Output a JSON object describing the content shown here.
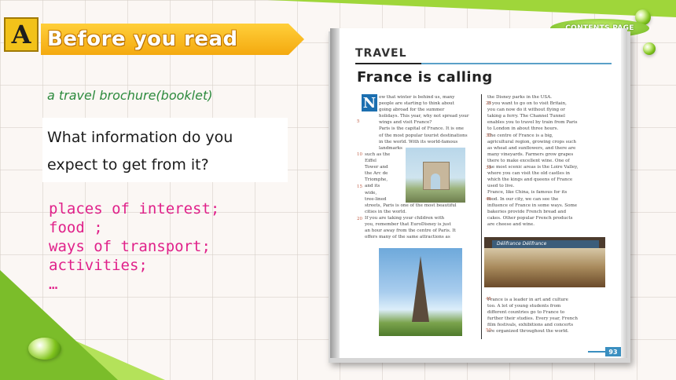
{
  "slide": {
    "badge_letter": "A",
    "title": "Before you read",
    "contents_button": "CONTENTS PAGE",
    "subtitle": "a travel brochure(booklet)",
    "question_lines": [
      "What information do you",
      "expect to get from it?"
    ],
    "answers": [
      "places of interest;",
      "food ;",
      "ways of transport;",
      "activities;",
      "…"
    ]
  },
  "magazine": {
    "section_label": "TRAVEL",
    "article_title": "France is calling",
    "dropcap": "N",
    "col1_top": [
      "ow that winter is behind us, many",
      "people are starting to think about",
      "going abroad for the summer",
      "holidays. This year, why not spread your",
      "wings and visit France?",
      "Paris is the capital of France. It is one",
      "of the most popular tourist destinations",
      "in the world. With its world-famous",
      "landmarks"
    ],
    "col1_side": [
      "such as the",
      "Eiffel",
      "Tower and",
      "the Arc de",
      "Triomphe,",
      "and its",
      "wide,",
      "tree-lined"
    ],
    "col1_bottom": [
      "streets, Paris is one of the most beautiful",
      "cities in the world.",
      "If you are taking your children with",
      "you, remember that EuroDisney is just",
      "an hour away from the centre of Paris. It",
      "offers many of the same attractions as"
    ],
    "col2_top": [
      "the Disney parks in the USA.",
      "If you want to go on to visit Britain,",
      "you can now do it without flying or",
      "taking a ferry. The Channel Tunnel",
      "enables you to travel by train from Paris",
      "to London in about three hours.",
      "The centre of France is a big,",
      "agricultural region, growing crops such",
      "as wheat and sunflowers, and there are",
      "many vineyards. Farmers grow grapes",
      "there to make excellent wine. One of",
      "the most scenic areas is the Loire Valley,",
      "where you can visit the old castles in",
      "which the kings and queens of France",
      "used to live.",
      "France, like China, is famous for its",
      "food. In our city, we can see the",
      "influence of France in some ways. Some",
      "bakeries provide French bread and",
      "cakes. Other popular French products",
      "are cheese and wine."
    ],
    "col2_bottom": [
      "France is a leader in art and culture",
      "too. A lot of young students from",
      "different countries go to France to",
      "further their studies. Every year, French",
      "film festivals, exhibitions and concerts",
      "are organized throughout the world."
    ],
    "line_numbers": [
      "5",
      "10",
      "15",
      "20",
      "25",
      "30",
      "35",
      "40",
      "45",
      "50"
    ],
    "shop_sign": "Délifrance      Délifrance",
    "page_number": "93"
  },
  "colors": {
    "accent_orange": "#f4a90f",
    "badge_yellow": "#f2c21a",
    "subtitle_green": "#2c8a3d",
    "answer_pink": "#e0218a",
    "brand_green": "#7bbd2a"
  }
}
